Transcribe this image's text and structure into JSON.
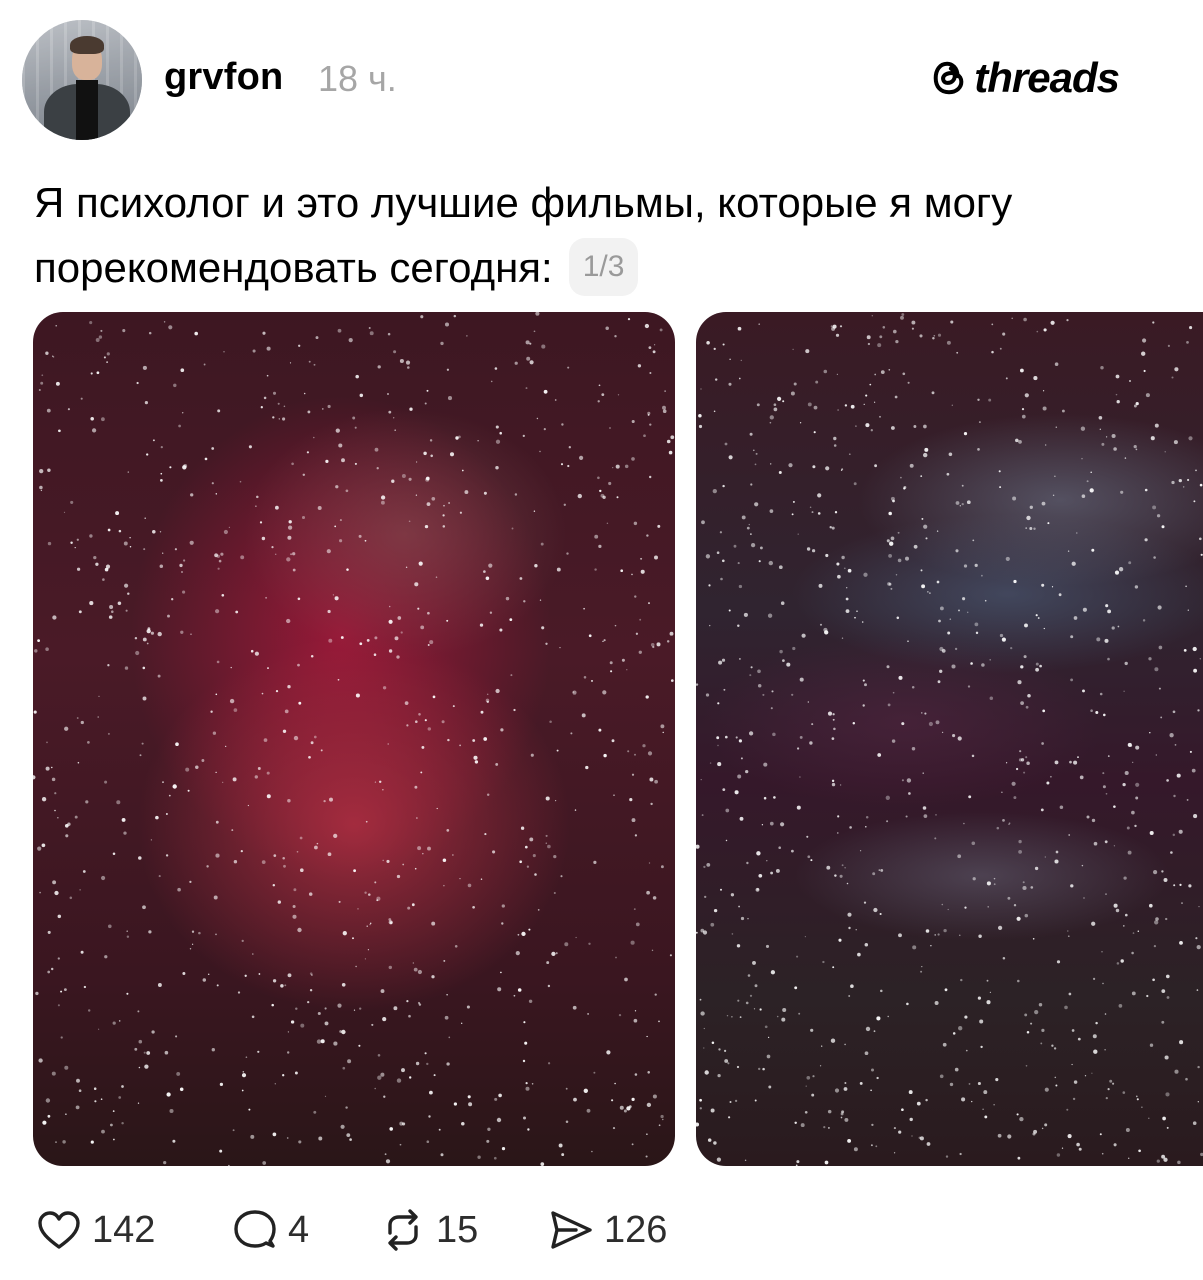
{
  "post": {
    "username": "grvfon",
    "time": "18 ч.",
    "brand": "threads",
    "caption": "Я психолог и это лучшие фильмы, которые я могу порекомендовать сегодня:",
    "counter": "1/3"
  },
  "media": [
    {
      "name": "image-1",
      "palette": [
        "#3d1722",
        "#aa193c",
        "#be3246"
      ]
    },
    {
      "name": "image-2",
      "palette": [
        "#3a1a24",
        "#50648c",
        "#6e788c"
      ]
    }
  ],
  "actions": {
    "likes": "142",
    "comments": "4",
    "reposts": "15",
    "shares": "126"
  },
  "icons": {
    "brand": "threads-logo-icon",
    "like": "heart-icon",
    "comment": "comment-bubble-icon",
    "repost": "repost-icon",
    "share": "send-icon"
  }
}
